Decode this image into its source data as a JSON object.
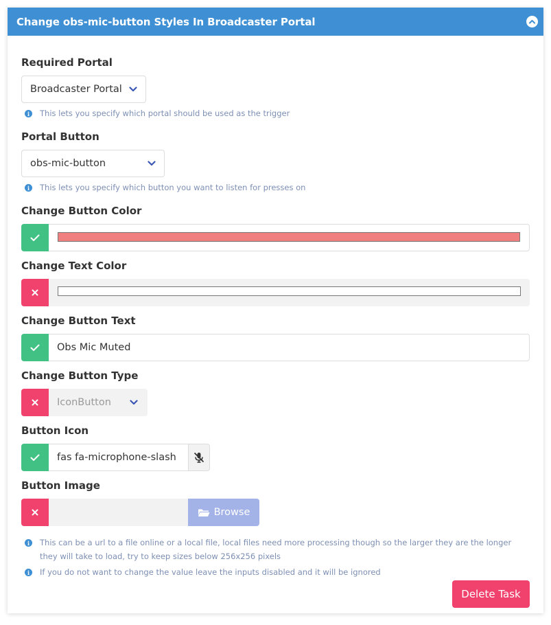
{
  "header": {
    "title": "Change obs-mic-button Styles In Broadcaster Portal"
  },
  "portal": {
    "label": "Required Portal",
    "value": "Broadcaster Portal",
    "help": "This lets you specify which portal should be used as the trigger"
  },
  "button": {
    "label": "Portal Button",
    "value": "obs-mic-button",
    "help": "This lets you specify which button you want to listen for presses on"
  },
  "button_color": {
    "label": "Change Button Color",
    "enabled": true,
    "value": "#f08080"
  },
  "text_color": {
    "label": "Change Text Color",
    "enabled": false,
    "value": "#ffffff"
  },
  "button_text": {
    "label": "Change Button Text",
    "enabled": true,
    "value": "Obs Mic Muted"
  },
  "button_type": {
    "label": "Change Button Type",
    "enabled": false,
    "value": "IconButton"
  },
  "button_icon": {
    "label": "Button Icon",
    "enabled": true,
    "value": "fas fa-microphone-slash",
    "preview_icon": "microphone-slash-icon"
  },
  "button_image": {
    "label": "Button Image",
    "enabled": false,
    "value": "",
    "browse_label": "Browse",
    "help": "This can be a url to a file online or a local file, local files need more processing though so the larger they are the longer they will take to load, try to keep sizes below 256x256 pixels"
  },
  "footer": {
    "help": "If you do not want to change the value leave the inputs disabled and it will be ignored",
    "delete_label": "Delete Task"
  },
  "colors": {
    "header": "#3e8fd4",
    "enabled_toggle": "#41c183",
    "disabled_toggle": "#f0426c",
    "browse": "#a3b3e8",
    "delete": "#f0426c",
    "chevron": "#3a56b5"
  }
}
